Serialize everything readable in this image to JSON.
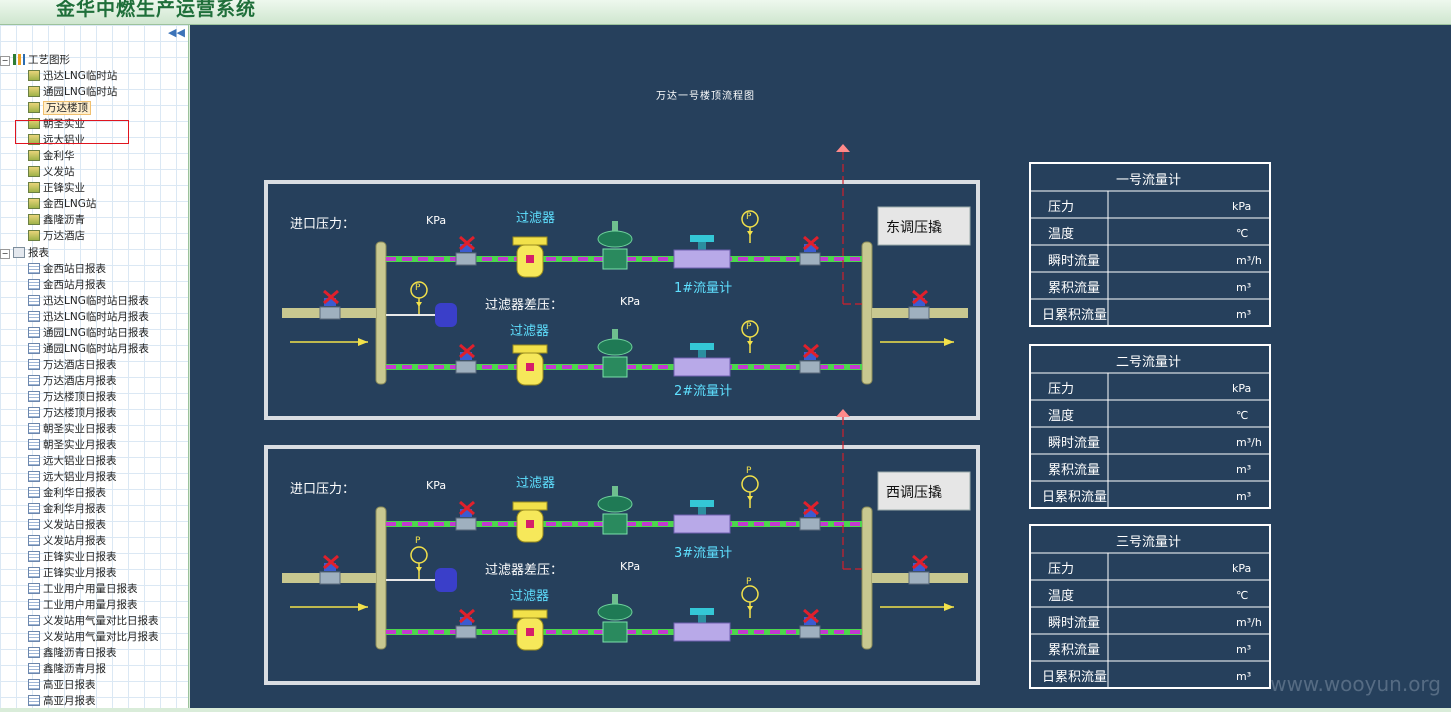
{
  "app": {
    "title": "金华中燃生产运营系统"
  },
  "sidebar": {
    "collapse_icon": "double-left-arrow-icon",
    "graphics_root": "工艺图形",
    "graphics_items": [
      "迅达LNG临时站",
      "通园LNG临时站",
      "万达楼顶",
      "朝圣实业",
      "远大铝业",
      "金利华",
      "义发站",
      "正锋实业",
      "金西LNG站",
      "鑫隆沥青",
      "万达酒店"
    ],
    "selected_item": "万达楼顶",
    "reports_root": "报表",
    "report_items": [
      "金西站日报表",
      "金西站月报表",
      "迅达LNG临时站日报表",
      "迅达LNG临时站月报表",
      "通园LNG临时站日报表",
      "通园LNG临时站月报表",
      "万达酒店日报表",
      "万达酒店月报表",
      "万达楼顶日报表",
      "万达楼顶月报表",
      "朝圣实业日报表",
      "朝圣实业月报表",
      "远大铝业日报表",
      "远大铝业月报表",
      "金利华日报表",
      "金利华月报表",
      "义发站日报表",
      "义发站月报表",
      "正锋实业日报表",
      "正锋实业月报表",
      "工业用户用量日报表",
      "工业用户用量月报表",
      "义发站用气量对比日报表",
      "义发站用气量对比月报表",
      "鑫隆沥青日报表",
      "鑫隆沥青月报",
      "高亚日报表",
      "高亚月报表"
    ]
  },
  "diagram": {
    "title": "万达一号楼顶流程图",
    "panels": [
      {
        "inlet_label": "进口压力：",
        "inlet_unit": "KPa",
        "dp_label": "过滤器差压：",
        "dp_unit": "KPa",
        "filter1": "过滤器",
        "filter2": "过滤器",
        "meter1": "1#流量计",
        "meter2": "2#流量计",
        "outlet": "东调压撬"
      },
      {
        "inlet_label": "进口压力：",
        "inlet_unit": "KPa",
        "dp_label": "过滤器差压：",
        "dp_unit": "KPa",
        "filter1": "过滤器",
        "filter2": "过滤器",
        "meter1": "3#流量计",
        "meter2": "",
        "outlet": "西调压撬"
      }
    ],
    "meters": [
      {
        "title": "一号流量计",
        "rows": [
          [
            "压力",
            "kPa"
          ],
          [
            "温度",
            "℃"
          ],
          [
            "瞬时流量",
            "m³/h"
          ],
          [
            "累积流量",
            "m³"
          ],
          [
            "日累积流量",
            "m³"
          ]
        ]
      },
      {
        "title": "二号流量计",
        "rows": [
          [
            "压力",
            "kPa"
          ],
          [
            "温度",
            "℃"
          ],
          [
            "瞬时流量",
            "m³/h"
          ],
          [
            "累积流量",
            "m³"
          ],
          [
            "日累积流量",
            "m³"
          ]
        ]
      },
      {
        "title": "三号流量计",
        "rows": [
          [
            "压力",
            "kPa"
          ],
          [
            "温度",
            "℃"
          ],
          [
            "瞬时流量",
            "m³/h"
          ],
          [
            "累积流量",
            "m³"
          ],
          [
            "日累积流量",
            "m³"
          ]
        ]
      }
    ],
    "gauge_symbol": "P"
  },
  "watermark": "www.wooyun.org",
  "colors": {
    "canvas": "#26405c",
    "pipe_green": "#4cd64c",
    "pipe_magenta": "#c23ad0",
    "pipe_yellow": "#c8c890",
    "label_cyan": "#5fe0ff",
    "valve_red": "#e0202c",
    "sidebar_selected_outline": "#e0151f"
  }
}
